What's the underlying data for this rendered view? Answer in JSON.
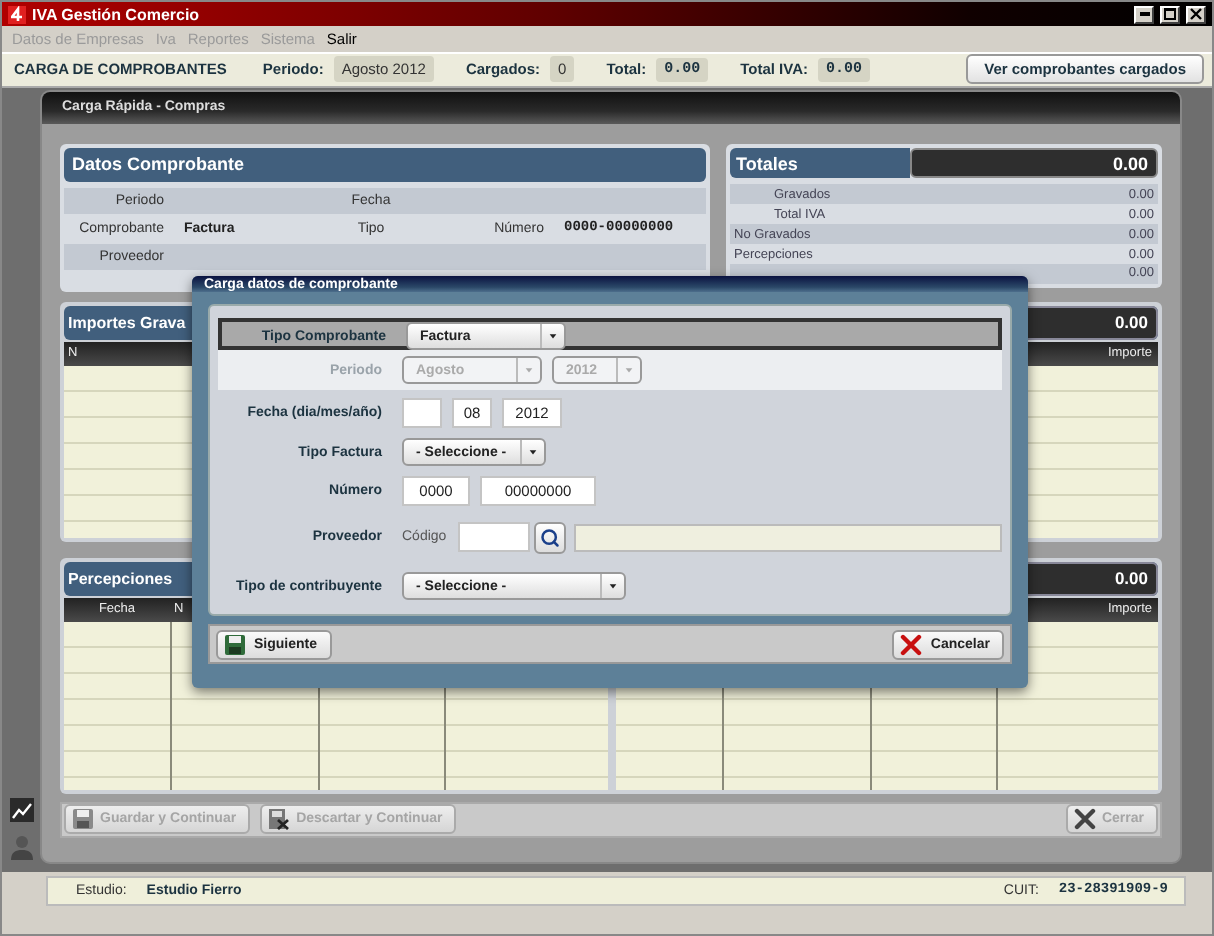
{
  "window": {
    "title": "IVA Gestión Comercio"
  },
  "menu": [
    {
      "label": "Datos de Empresas",
      "disabled": true
    },
    {
      "label": "Iva",
      "disabled": true
    },
    {
      "label": "Reportes",
      "disabled": true
    },
    {
      "label": "Sistema",
      "disabled": true
    },
    {
      "label": "Salir",
      "disabled": false
    }
  ],
  "header": {
    "title": "CARGA DE COMPROBANTES",
    "fields": [
      {
        "label": "Periodo:",
        "value": "Agosto 2012",
        "kind": "text"
      },
      {
        "label": "Cargados:",
        "value": "0",
        "kind": "text"
      },
      {
        "label": "Total:",
        "value": "0.00",
        "kind": "amount"
      },
      {
        "label": "Total IVA:",
        "value": "0.00",
        "kind": "amount"
      }
    ],
    "button": "Ver comprobantes cargados"
  },
  "panel": {
    "title": "Carga Rápida - Compras"
  },
  "datos": {
    "title": "Datos Comprobante",
    "rows": [
      [
        {
          "label": "Periodo"
        },
        {
          "label": "Fecha"
        }
      ],
      [
        {
          "label": "Comprobante",
          "value": "Factura"
        },
        {
          "label": "Tipo"
        },
        {
          "label": "Número",
          "value": "0000-00000000"
        }
      ],
      [
        {
          "label": "Proveedor"
        }
      ]
    ]
  },
  "totales": {
    "title": "Totales",
    "total": "0.00",
    "rows": [
      {
        "label": "Gravados",
        "value": "0.00",
        "kind": "sub"
      },
      {
        "label": "Total IVA",
        "value": "0.00",
        "kind": "sub"
      },
      {
        "label": "No Gravados",
        "value": "0.00",
        "kind": "main"
      },
      {
        "label": "Percepciones",
        "value": "0.00",
        "kind": "main"
      },
      {
        "value": "0.00"
      }
    ]
  },
  "importes": {
    "title": "Importes Grava",
    "total": "0.00",
    "columns": [
      {
        "label": "N",
        "kind": "left"
      },
      {
        "label": "Importe",
        "kind": "right"
      }
    ]
  },
  "percepciones": {
    "title": "Percepciones",
    "total": "0.00",
    "columns": [
      {
        "label": "Fecha",
        "kind": "left"
      },
      {
        "label": "N",
        "kind": "left"
      },
      {
        "label": "Importe",
        "kind": "right"
      }
    ]
  },
  "actions": [
    {
      "label": "Guardar y Continuar",
      "disabled": true,
      "kind": "save"
    },
    {
      "label": "Descartar y Continuar",
      "disabled": true,
      "kind": "discard"
    },
    {
      "label": "Cerrar",
      "disabled": true,
      "kind": "close"
    }
  ],
  "footer": [
    {
      "label": "Estudio:",
      "value": "Estudio Fierro"
    },
    {
      "label": "CUIT:",
      "value": "23-28391909-9"
    }
  ],
  "dialog": {
    "title": "Carga datos de comprobante",
    "rows": [
      {
        "kind": "select",
        "label": "Tipo Comprobante",
        "highlighted": true,
        "disabled": false,
        "selects": [
          "Factura"
        ]
      },
      {
        "kind": "select",
        "label": "Periodo",
        "highlighted": false,
        "disabled": true,
        "selects": [
          "Agosto",
          "2012"
        ]
      },
      {
        "kind": "inputs",
        "label": "Fecha (dia/mes/año)",
        "fields": [
          {
            "kind": "blank"
          },
          {
            "kind": "filled",
            "value": "08"
          },
          {
            "kind": "filled",
            "value": "2012"
          }
        ]
      },
      {
        "kind": "select",
        "label": "Tipo Factura",
        "highlighted": false,
        "disabled": false,
        "selects": [
          "- Seleccione -"
        ]
      },
      {
        "kind": "inputs",
        "label": "Número",
        "fields": [
          {
            "kind": "filled",
            "value": "0000"
          },
          {
            "kind": "filled",
            "value": "00000000"
          }
        ]
      },
      {
        "kind": "supplier",
        "label": "Proveedor",
        "sublabel": "Código"
      },
      {
        "kind": "select",
        "label": "Tipo de contribuyente",
        "highlighted": false,
        "disabled": false,
        "selects": [
          "- Seleccione -"
        ]
      }
    ],
    "buttons": [
      {
        "label": "Siguiente",
        "kind": "save"
      },
      {
        "label": "Cancelar",
        "kind": "cancel"
      }
    ]
  }
}
